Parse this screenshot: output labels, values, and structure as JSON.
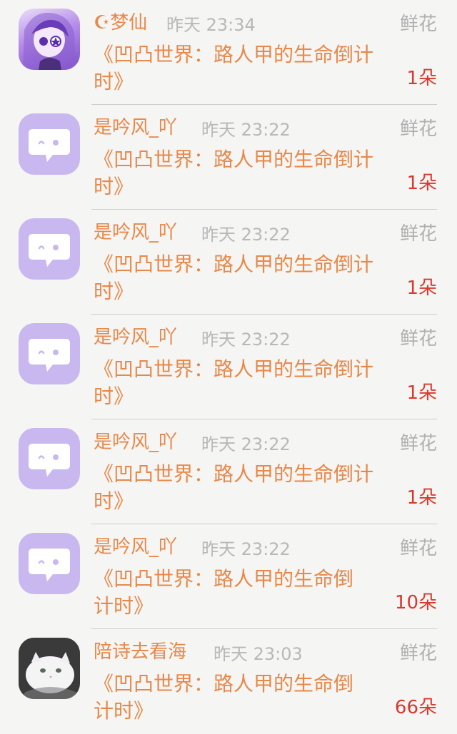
{
  "notifications": [
    {
      "avatar": "anime-avatar",
      "username": "☪梦仙",
      "time": "昨天 23:34",
      "gift_type": "鲜花",
      "book_title_line1": "《凹凸世界：路人甲的生命倒计",
      "book_title_line2": "时》",
      "count": "1朵"
    },
    {
      "avatar": "default-avatar",
      "username": "是吟风_吖",
      "time": "昨天 23:22",
      "gift_type": "鲜花",
      "book_title_line1": "《凹凸世界：路人甲的生命倒计",
      "book_title_line2": "时》",
      "count": "1朵"
    },
    {
      "avatar": "default-avatar",
      "username": "是吟风_吖",
      "time": "昨天 23:22",
      "gift_type": "鲜花",
      "book_title_line1": "《凹凸世界：路人甲的生命倒计",
      "book_title_line2": "时》",
      "count": "1朵"
    },
    {
      "avatar": "default-avatar",
      "username": "是吟风_吖",
      "time": "昨天 23:22",
      "gift_type": "鲜花",
      "book_title_line1": "《凹凸世界：路人甲的生命倒计",
      "book_title_line2": "时》",
      "count": "1朵"
    },
    {
      "avatar": "default-avatar",
      "username": "是吟风_吖",
      "time": "昨天 23:22",
      "gift_type": "鲜花",
      "book_title_line1": "《凹凸世界：路人甲的生命倒计",
      "book_title_line2": "时》",
      "count": "1朵"
    },
    {
      "avatar": "default-avatar",
      "username": "是吟风_吖",
      "time": "昨天 23:22",
      "gift_type": "鲜花",
      "book_title_line1": "《凹凸世界：路人甲的生命倒",
      "book_title_line2": "计时》",
      "count": "10朵"
    },
    {
      "avatar": "cat-avatar",
      "username": "陪诗去看海",
      "time": "昨天 23:03",
      "gift_type": "鲜花",
      "book_title_line1": "《凹凸世界：路人甲的生命倒",
      "book_title_line2": "计时》",
      "count": "66朵"
    }
  ]
}
